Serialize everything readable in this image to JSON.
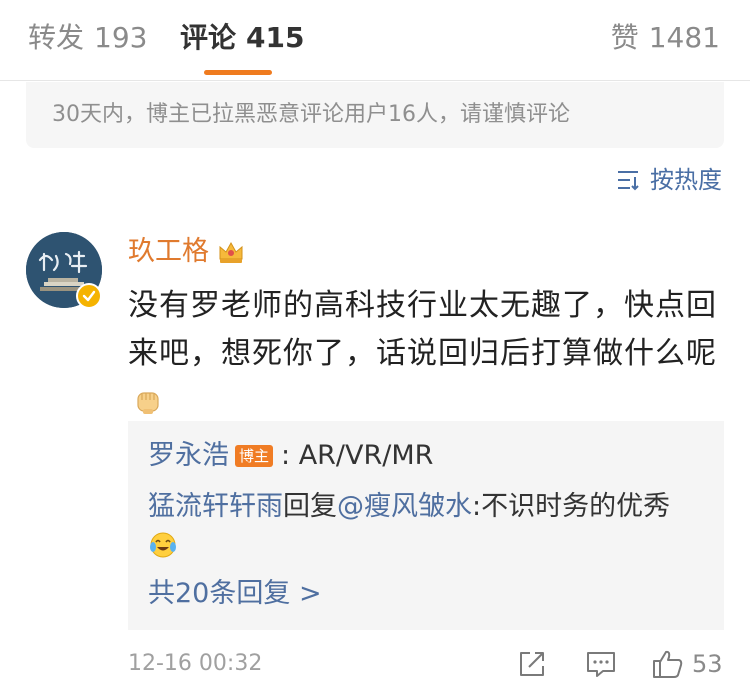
{
  "tabs": {
    "repost_label": "转发",
    "repost_count": "193",
    "comment_label": "评论",
    "comment_count": "415",
    "like_label": "赞",
    "like_count": "1481"
  },
  "notice": "30天内，博主已拉黑恶意评论用户16人，请谨慎评论",
  "sort_label": "按热度",
  "comment": {
    "username": "玖工格",
    "text": "没有罗老师的高科技行业太无趣了，快点回来吧，想死你了，话说回归后打算做什么呢",
    "timestamp": "12-16 00:32",
    "like_count": "53",
    "replies": [
      {
        "user": "罗永浩",
        "badge": "博主",
        "text": ": AR/VR/MR"
      },
      {
        "user": "猛流轩轩雨",
        "action": "回复",
        "mention": "@瘦风皱水",
        "text": ":不识时务的优秀"
      }
    ],
    "more_replies": "共20条回复 >"
  },
  "colors": {
    "accent_orange": "#ef7b1f",
    "link_blue": "#4f6fa0",
    "username_orange": "#e07a2e"
  }
}
